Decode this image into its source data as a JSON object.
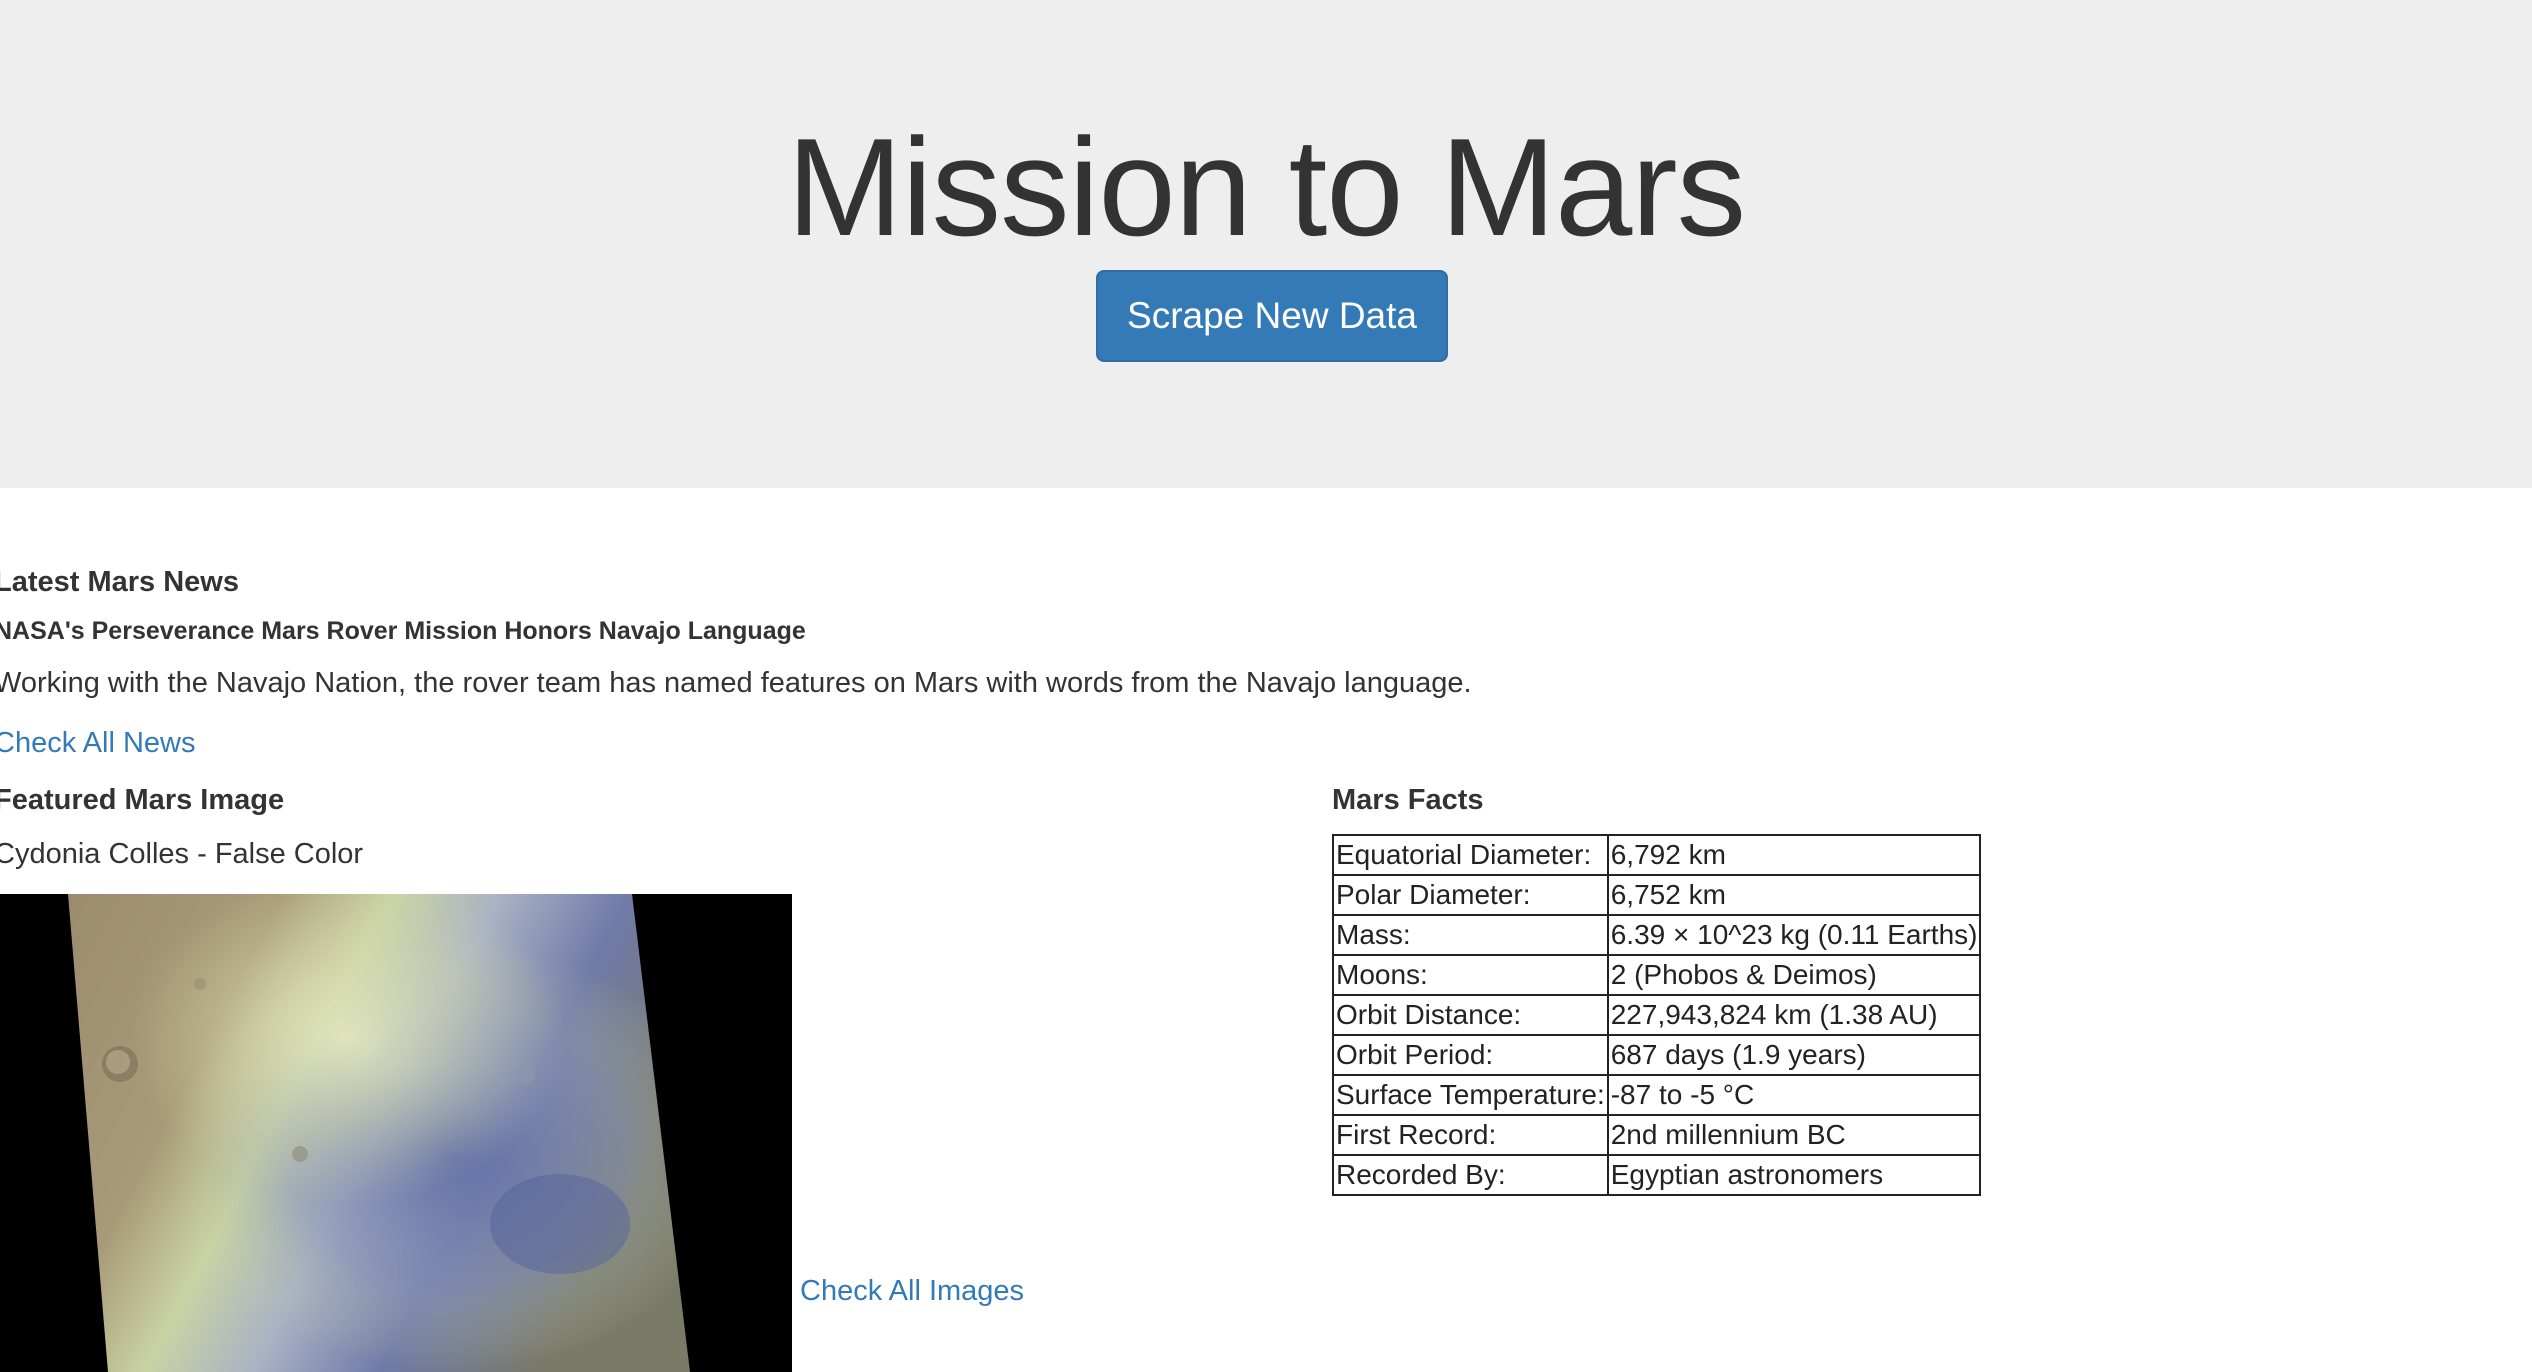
{
  "header": {
    "title": "Mission to Mars",
    "scrape_button_label": "Scrape New Data"
  },
  "news": {
    "section_title": "Latest Mars News",
    "headline": "NASA's Perseverance Mars Rover Mission Honors Navajo Language",
    "teaser": "Working with the Navajo Nation, the rover team has named features on Mars with words from the Navajo language.",
    "link_label": "Check All News"
  },
  "featured_image": {
    "section_title": "Featured Mars Image",
    "caption": "Cydonia Colles - False Color",
    "link_label": "Check All Images"
  },
  "facts": {
    "section_title": "Mars Facts",
    "rows": [
      {
        "label": "Equatorial Diameter:",
        "value": "6,792 km"
      },
      {
        "label": "Polar Diameter:",
        "value": "6,752 km"
      },
      {
        "label": "Mass:",
        "value": "6.39 × 10^23 kg (0.11 Earths)"
      },
      {
        "label": "Moons:",
        "value": "2 (Phobos & Deimos)"
      },
      {
        "label": "Orbit Distance:",
        "value": "227,943,824 km (1.38 AU)"
      },
      {
        "label": "Orbit Period:",
        "value": "687 days (1.9 years)"
      },
      {
        "label": "Surface Temperature:",
        "value": "-87 to -5 °C"
      },
      {
        "label": "First Record:",
        "value": "2nd millennium BC"
      },
      {
        "label": "Recorded By:",
        "value": "Egyptian astronomers"
      }
    ]
  },
  "colors": {
    "accent": "#337ab7",
    "jumbotron_bg": "#eeeeee",
    "text": "#333333"
  }
}
